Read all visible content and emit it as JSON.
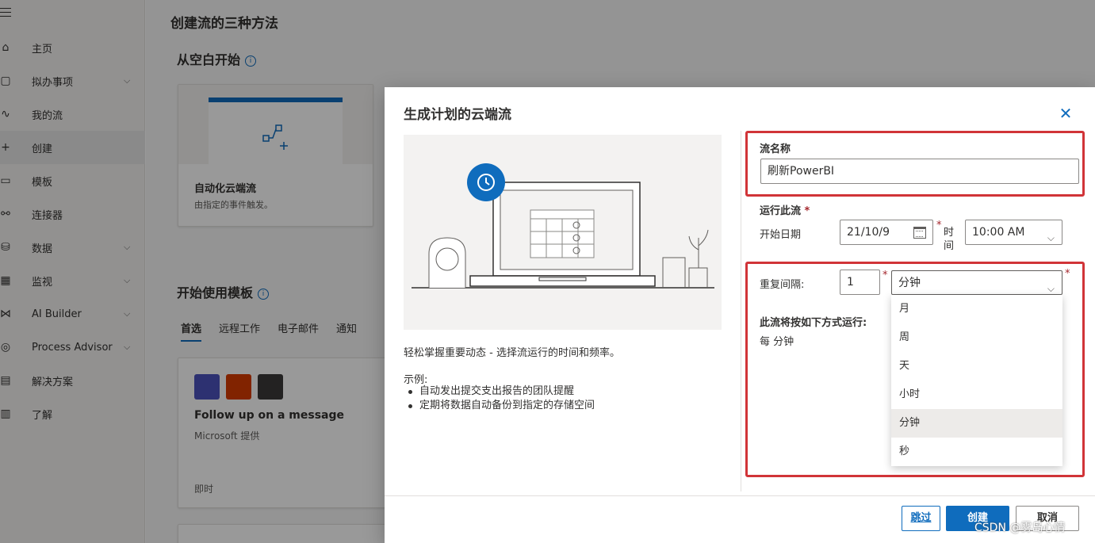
{
  "nav": {
    "items": [
      {
        "label": "主页",
        "icon": "home-icon",
        "glyph": "⌂",
        "chev": false
      },
      {
        "label": "拟办事项",
        "icon": "clipboard-icon",
        "glyph": "▢",
        "chev": true
      },
      {
        "label": "我的流",
        "icon": "flow-icon",
        "glyph": "∿",
        "chev": false
      },
      {
        "label": "创建",
        "icon": "plus-icon",
        "glyph": "+",
        "chev": false,
        "active": true
      },
      {
        "label": "模板",
        "icon": "template-icon",
        "glyph": "▭",
        "chev": false
      },
      {
        "label": "连接器",
        "icon": "connector-icon",
        "glyph": "⚯",
        "chev": false
      },
      {
        "label": "数据",
        "icon": "database-icon",
        "glyph": "⛁",
        "chev": true
      },
      {
        "label": "监视",
        "icon": "monitor-icon",
        "glyph": "▦",
        "chev": true
      },
      {
        "label": "AI Builder",
        "icon": "ai-builder-icon",
        "glyph": "⋈",
        "chev": true
      },
      {
        "label": "Process Advisor",
        "icon": "process-advisor-icon",
        "glyph": "◎",
        "chev": true
      },
      {
        "label": "解决方案",
        "icon": "solutions-icon",
        "glyph": "▤",
        "chev": false
      },
      {
        "label": "了解",
        "icon": "book-icon",
        "glyph": "▥",
        "chev": false
      }
    ]
  },
  "main": {
    "title": "创建流的三种方法",
    "blank_section": "从空白开始",
    "template_section": "开始使用模板",
    "card1": {
      "title": "自动化云端流",
      "subtitle": "由指定的事件触发。"
    },
    "tabs": [
      "首选",
      "远程工作",
      "电子邮件",
      "通知"
    ],
    "template_card": {
      "title": "Follow up on a message",
      "provider": "Microsoft 提供",
      "type": "即时"
    }
  },
  "dialog": {
    "title": "生成计划的云端流",
    "description": "轻松掌握重要动态 - 选择流运行的时间和频率。",
    "examples_title": "示例:",
    "examples": [
      "自动发出提交支出报告的团队提醒",
      "定期将数据自动备份到指定的存储空间"
    ],
    "flow_name_label": "流名称",
    "flow_name_value": "刷新PowerBI",
    "run_label": "运行此流",
    "required_mark": "*",
    "start_date_label": "开始日期",
    "start_date_value": "21/10/9",
    "time_label": "时间",
    "time_value": "10:00 AM",
    "repeat_label": "重复间隔:",
    "repeat_value": "1",
    "unit_value": "分钟",
    "run_summary_label": "此流将按如下方式运行:",
    "run_summary_value": "每 分钟",
    "unit_options": [
      "月",
      "周",
      "天",
      "小时",
      "分钟",
      "秒"
    ],
    "selected_option": "分钟",
    "buttons": {
      "skip": "跳过",
      "create": "创建",
      "cancel": "取消"
    }
  },
  "watermark": "CSDN @雾岛心情",
  "colors": {
    "accent": "#0f6cbd",
    "highlight": "#d13438"
  }
}
